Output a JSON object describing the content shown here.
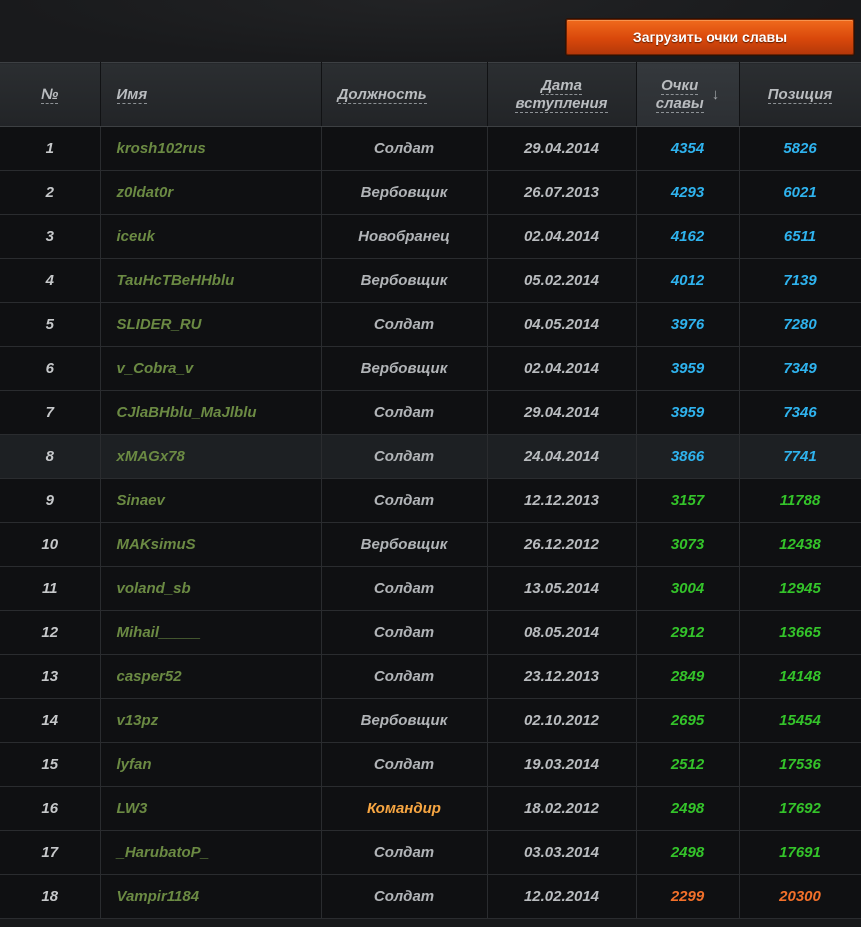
{
  "toolbar": {
    "load_button_label": "Загрузить очки славы"
  },
  "table": {
    "headers": {
      "num": "№",
      "name": "Имя",
      "role": "Должность",
      "date_line1": "Дата",
      "date_line2": "вступления",
      "points_line1": "Очки",
      "points_line2": "славы",
      "position": "Позиция"
    },
    "sort_icon": "arrow-down-icon",
    "colors": {
      "blue": "#2fb3ee",
      "green": "#34c42a",
      "orange": "#f2702a",
      "commander": "#f7a642",
      "name": "#6b8a43"
    },
    "rows": [
      {
        "num": "1",
        "name": "krosh102rus",
        "role": "Солдат",
        "date": "29.04.2014",
        "points": "4354",
        "position": "5826",
        "tier": "blue"
      },
      {
        "num": "2",
        "name": "z0ldat0r",
        "role": "Вербовщик",
        "date": "26.07.2013",
        "points": "4293",
        "position": "6021",
        "tier": "blue"
      },
      {
        "num": "3",
        "name": "iceuk",
        "role": "Новобранец",
        "date": "02.04.2014",
        "points": "4162",
        "position": "6511",
        "tier": "blue"
      },
      {
        "num": "4",
        "name": "TauHcTBeHHblu",
        "role": "Вербовщик",
        "date": "05.02.2014",
        "points": "4012",
        "position": "7139",
        "tier": "blue"
      },
      {
        "num": "5",
        "name": "SLIDER_RU",
        "role": "Солдат",
        "date": "04.05.2014",
        "points": "3976",
        "position": "7280",
        "tier": "blue"
      },
      {
        "num": "6",
        "name": "v_Cobra_v",
        "role": "Вербовщик",
        "date": "02.04.2014",
        "points": "3959",
        "position": "7349",
        "tier": "blue"
      },
      {
        "num": "7",
        "name": "CJlaBHblu_MaJlblu",
        "role": "Солдат",
        "date": "29.04.2014",
        "points": "3959",
        "position": "7346",
        "tier": "blue"
      },
      {
        "num": "8",
        "name": "xMAGx78",
        "role": "Солдат",
        "date": "24.04.2014",
        "points": "3866",
        "position": "7741",
        "tier": "blue",
        "hovered": true
      },
      {
        "num": "9",
        "name": "Sinaev",
        "role": "Солдат",
        "date": "12.12.2013",
        "points": "3157",
        "position": "11788",
        "tier": "green"
      },
      {
        "num": "10",
        "name": "MAKsimuS",
        "role": "Вербовщик",
        "date": "26.12.2012",
        "points": "3073",
        "position": "12438",
        "tier": "green"
      },
      {
        "num": "11",
        "name": "voland_sb",
        "role": "Солдат",
        "date": "13.05.2014",
        "points": "3004",
        "position": "12945",
        "tier": "green"
      },
      {
        "num": "12",
        "name": "Mihail_____",
        "role": "Солдат",
        "date": "08.05.2014",
        "points": "2912",
        "position": "13665",
        "tier": "green"
      },
      {
        "num": "13",
        "name": "casper52",
        "role": "Солдат",
        "date": "23.12.2013",
        "points": "2849",
        "position": "14148",
        "tier": "green"
      },
      {
        "num": "14",
        "name": "v13pz",
        "role": "Вербовщик",
        "date": "02.10.2012",
        "points": "2695",
        "position": "15454",
        "tier": "green"
      },
      {
        "num": "15",
        "name": "lyfan",
        "role": "Солдат",
        "date": "19.03.2014",
        "points": "2512",
        "position": "17536",
        "tier": "green"
      },
      {
        "num": "16",
        "name": "LW3",
        "role": "Командир",
        "date": "18.02.2012",
        "points": "2498",
        "position": "17692",
        "tier": "green",
        "commander": true
      },
      {
        "num": "17",
        "name": "_HarubatoP_",
        "role": "Солдат",
        "date": "03.03.2014",
        "points": "2498",
        "position": "17691",
        "tier": "green"
      },
      {
        "num": "18",
        "name": "Vampir1184",
        "role": "Солдат",
        "date": "12.02.2014",
        "points": "2299",
        "position": "20300",
        "tier": "orange"
      }
    ]
  }
}
